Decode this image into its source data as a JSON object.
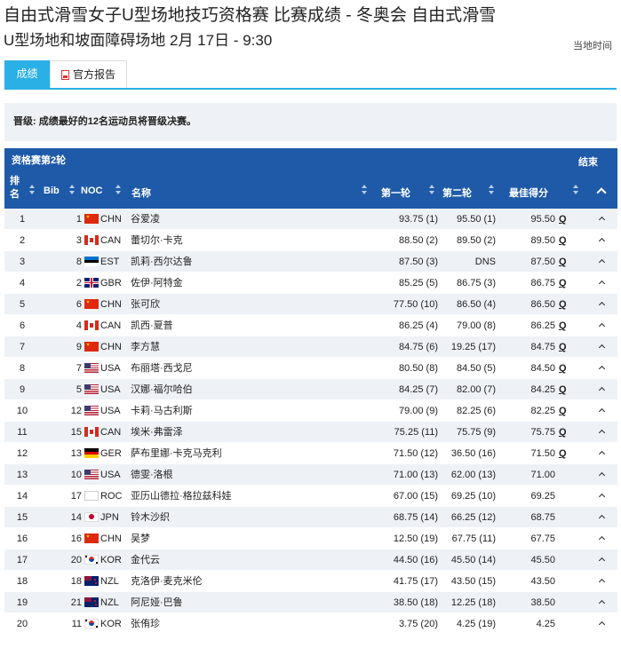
{
  "header": {
    "title": "自由式滑雪女子U型场地技巧资格赛 比赛成绩 - 冬奥会 自由式滑雪",
    "subtitle": "U型场地和坡面障碍场地 2月 17日 - 9:30",
    "local_time": "当地时间"
  },
  "tabs": [
    {
      "label": "成绩",
      "active": true
    },
    {
      "label": "官方报告",
      "active": false,
      "icon": "pdf-icon"
    }
  ],
  "notice": "晋级: 成绩最好的12名运动员将晋级决赛。",
  "table": {
    "round_label": "资格赛第2轮",
    "status_label": "结束",
    "columns": {
      "rank": "排名",
      "bib": "Bib",
      "noc": "NOC",
      "name": "名称",
      "run1": "第一轮",
      "run2": "第二轮",
      "best": "最佳得分"
    },
    "rows": [
      {
        "rank": "1",
        "bib": "1",
        "noc": "CHN",
        "name": "谷爱凌",
        "run1": "93.75 (1)",
        "run2": "95.50 (1)",
        "best": "95.50",
        "q": "Q"
      },
      {
        "rank": "2",
        "bib": "3",
        "noc": "CAN",
        "name": "蕾切尔·卡克",
        "run1": "88.50 (2)",
        "run2": "89.50 (2)",
        "best": "89.50",
        "q": "Q"
      },
      {
        "rank": "3",
        "bib": "8",
        "noc": "EST",
        "name": "凯莉·西尔达鲁",
        "run1": "87.50 (3)",
        "run2": "DNS",
        "best": "87.50",
        "q": "Q"
      },
      {
        "rank": "4",
        "bib": "2",
        "noc": "GBR",
        "name": "佐伊·阿特金",
        "run1": "85.25 (5)",
        "run2": "86.75 (3)",
        "best": "86.75",
        "q": "Q"
      },
      {
        "rank": "5",
        "bib": "6",
        "noc": "CHN",
        "name": "张可欣",
        "run1": "77.50 (10)",
        "run2": "86.50 (4)",
        "best": "86.50",
        "q": "Q"
      },
      {
        "rank": "6",
        "bib": "4",
        "noc": "CAN",
        "name": "凯西·夏普",
        "run1": "86.25 (4)",
        "run2": "79.00 (8)",
        "best": "86.25",
        "q": "Q"
      },
      {
        "rank": "7",
        "bib": "9",
        "noc": "CHN",
        "name": "李方慧",
        "run1": "84.75 (6)",
        "run2": "19.25 (17)",
        "best": "84.75",
        "q": "Q"
      },
      {
        "rank": "8",
        "bib": "7",
        "noc": "USA",
        "name": "布丽塔·西戈尼",
        "run1": "80.50 (8)",
        "run2": "84.50 (5)",
        "best": "84.50",
        "q": "Q"
      },
      {
        "rank": "9",
        "bib": "5",
        "noc": "USA",
        "name": "汉娜·福尔哈伯",
        "run1": "84.25 (7)",
        "run2": "82.00 (7)",
        "best": "84.25",
        "q": "Q"
      },
      {
        "rank": "10",
        "bib": "12",
        "noc": "USA",
        "name": "卡莉·马古利斯",
        "run1": "79.00 (9)",
        "run2": "82.25 (6)",
        "best": "82.25",
        "q": "Q"
      },
      {
        "rank": "11",
        "bib": "15",
        "noc": "CAN",
        "name": "埃米·弗雷泽",
        "run1": "75.25 (11)",
        "run2": "75.75 (9)",
        "best": "75.75",
        "q": "Q"
      },
      {
        "rank": "12",
        "bib": "13",
        "noc": "GER",
        "name": "萨布里娜·卡克马克利",
        "run1": "71.50 (12)",
        "run2": "36.50 (16)",
        "best": "71.50",
        "q": "Q"
      },
      {
        "rank": "13",
        "bib": "10",
        "noc": "USA",
        "name": "德雯·洛根",
        "run1": "71.00 (13)",
        "run2": "62.00 (13)",
        "best": "71.00",
        "q": ""
      },
      {
        "rank": "14",
        "bib": "17",
        "noc": "ROC",
        "name": "亚历山德拉·格拉兹科娃",
        "run1": "67.00 (15)",
        "run2": "69.25 (10)",
        "best": "69.25",
        "q": ""
      },
      {
        "rank": "15",
        "bib": "14",
        "noc": "JPN",
        "name": "铃木沙织",
        "run1": "68.75 (14)",
        "run2": "66.25 (12)",
        "best": "68.75",
        "q": ""
      },
      {
        "rank": "16",
        "bib": "16",
        "noc": "CHN",
        "name": "吴梦",
        "run1": "12.50 (19)",
        "run2": "67.75 (11)",
        "best": "67.75",
        "q": ""
      },
      {
        "rank": "17",
        "bib": "20",
        "noc": "KOR",
        "name": "金代云",
        "run1": "44.50 (16)",
        "run2": "45.50 (14)",
        "best": "45.50",
        "q": ""
      },
      {
        "rank": "18",
        "bib": "18",
        "noc": "NZL",
        "name": "克洛伊·麦克米伦",
        "run1": "41.75 (17)",
        "run2": "43.50 (15)",
        "best": "43.50",
        "q": ""
      },
      {
        "rank": "19",
        "bib": "21",
        "noc": "NZL",
        "name": "阿尼娅·巴鲁",
        "run1": "38.50 (18)",
        "run2": "12.25 (18)",
        "best": "38.50",
        "q": ""
      },
      {
        "rank": "20",
        "bib": "11",
        "noc": "KOR",
        "name": "张侑珍",
        "run1": "3.75 (20)",
        "run2": "4.25 (19)",
        "best": "4.25",
        "q": ""
      }
    ]
  },
  "colors": {
    "accent": "#2ab0e5",
    "table_header": "#1e5aa8",
    "row_alt": "#eef2f7"
  }
}
